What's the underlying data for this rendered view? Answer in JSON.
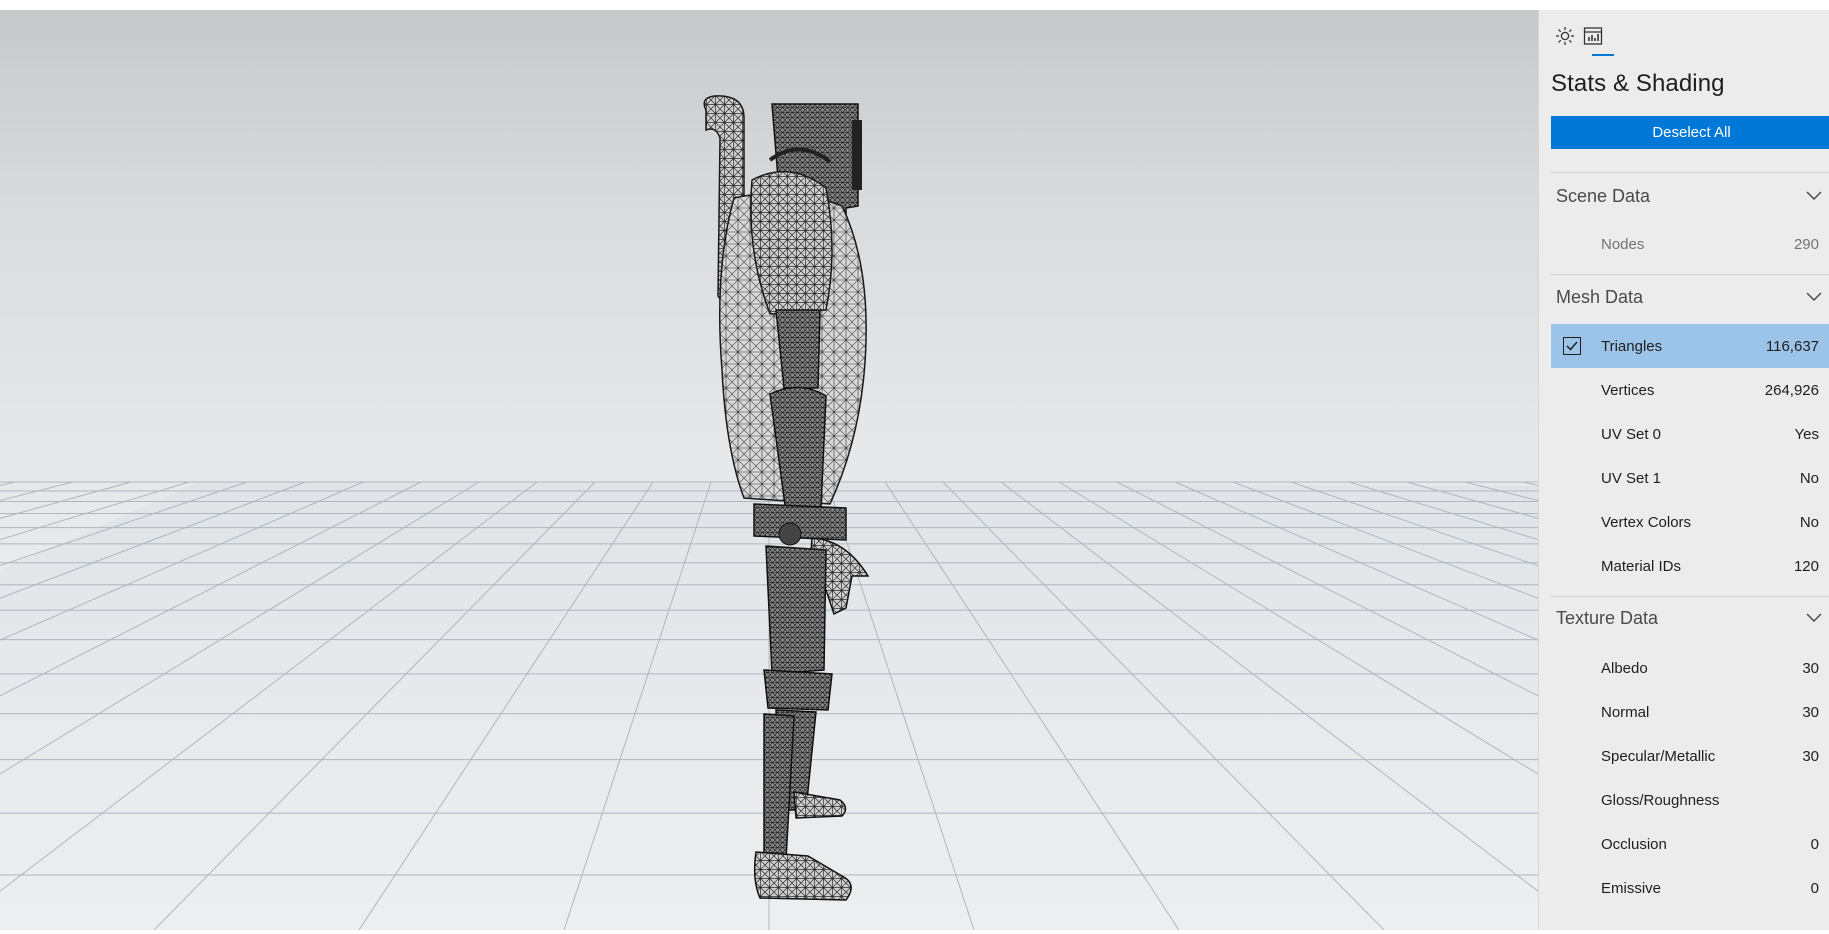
{
  "panel": {
    "title": "Stats & Shading",
    "deselect_label": "Deselect All",
    "tabs": [
      {
        "icon": "sun-icon",
        "selected": false
      },
      {
        "icon": "stats-icon",
        "selected": true
      }
    ],
    "sections": {
      "scene": {
        "header": "Scene Data",
        "rows": [
          {
            "label": "Nodes",
            "value": "290"
          }
        ]
      },
      "mesh": {
        "header": "Mesh Data",
        "rows": [
          {
            "label": "Triangles",
            "value": "116,637",
            "checked": true
          },
          {
            "label": "Vertices",
            "value": "264,926"
          },
          {
            "label": "UV Set 0",
            "value": "Yes"
          },
          {
            "label": "UV Set 1",
            "value": "No"
          },
          {
            "label": "Vertex Colors",
            "value": "No"
          },
          {
            "label": "Material IDs",
            "value": "120"
          }
        ]
      },
      "texture": {
        "header": "Texture Data",
        "rows": [
          {
            "label": "Albedo",
            "value": "30"
          },
          {
            "label": "Normal",
            "value": "30"
          },
          {
            "label": "Specular/Metallic",
            "value": "30"
          },
          {
            "label": "Gloss/Roughness",
            "value": ""
          },
          {
            "label": "Occlusion",
            "value": "0"
          },
          {
            "label": "Emissive",
            "value": "0"
          }
        ]
      }
    }
  },
  "colors": {
    "accent": "#0078d7",
    "selected_row": "#9cc4e8",
    "panel_bg": "#ececec"
  }
}
